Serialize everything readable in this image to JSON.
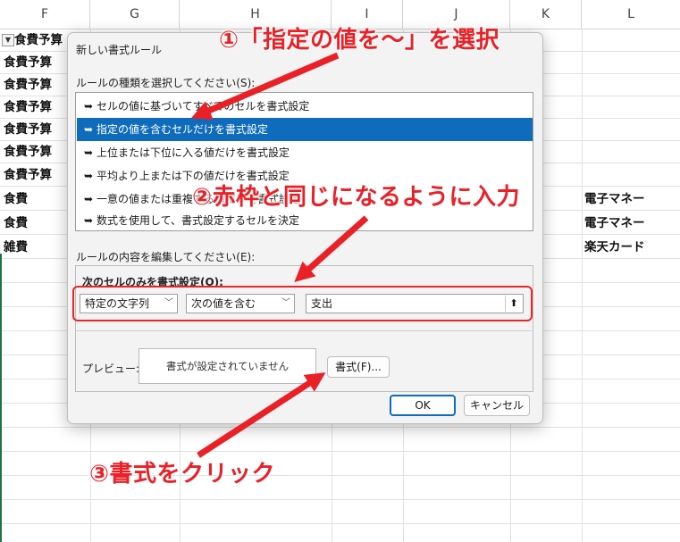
{
  "sheet": {
    "columns": [
      "F",
      "G",
      "H",
      "I",
      "J",
      "K",
      "L"
    ],
    "col_f_cells": [
      "食費予算",
      "食費予算",
      "食費予算",
      "食費予算",
      "食費予算",
      "食費予算",
      "食費予算",
      "食費",
      "食費",
      "雑費"
    ],
    "col_l_cells": [
      "電子マネー",
      "電子マネー",
      "楽天カード"
    ],
    "filter_glyph": "▼"
  },
  "dialog": {
    "title": "新しい書式ルール",
    "rule_type_label": "ルールの種類を選択してください(S):",
    "rule_types": [
      "セルの値に基づいてすべてのセルを書式設定",
      "指定の値を含むセルだけを書式設定",
      "上位または下位に入る値だけを書式設定",
      "平均より上または下の値だけを書式設定",
      "一意の値または重複する値だけを書式設定",
      "数式を使用して、書式設定するセルを決定"
    ],
    "selected_index": 1,
    "edit_label": "ルールの内容を編集してください(E):",
    "format_only_label": "次のセルのみを書式設定(O):",
    "select1_value": "特定の文字列",
    "select2_value": "次の値を含む",
    "value_input": "支出",
    "preview_label": "プレビュー:",
    "preview_text": "書式が設定されていません",
    "format_button": "書式(F)...",
    "ok_button": "OK",
    "cancel_button": "キャンセル"
  },
  "annotations": {
    "step1": "①「指定の値を～」を選択",
    "step2": "②赤枠と同じになるように入力",
    "step3": "③書式をクリック",
    "color": "#ea2027"
  }
}
